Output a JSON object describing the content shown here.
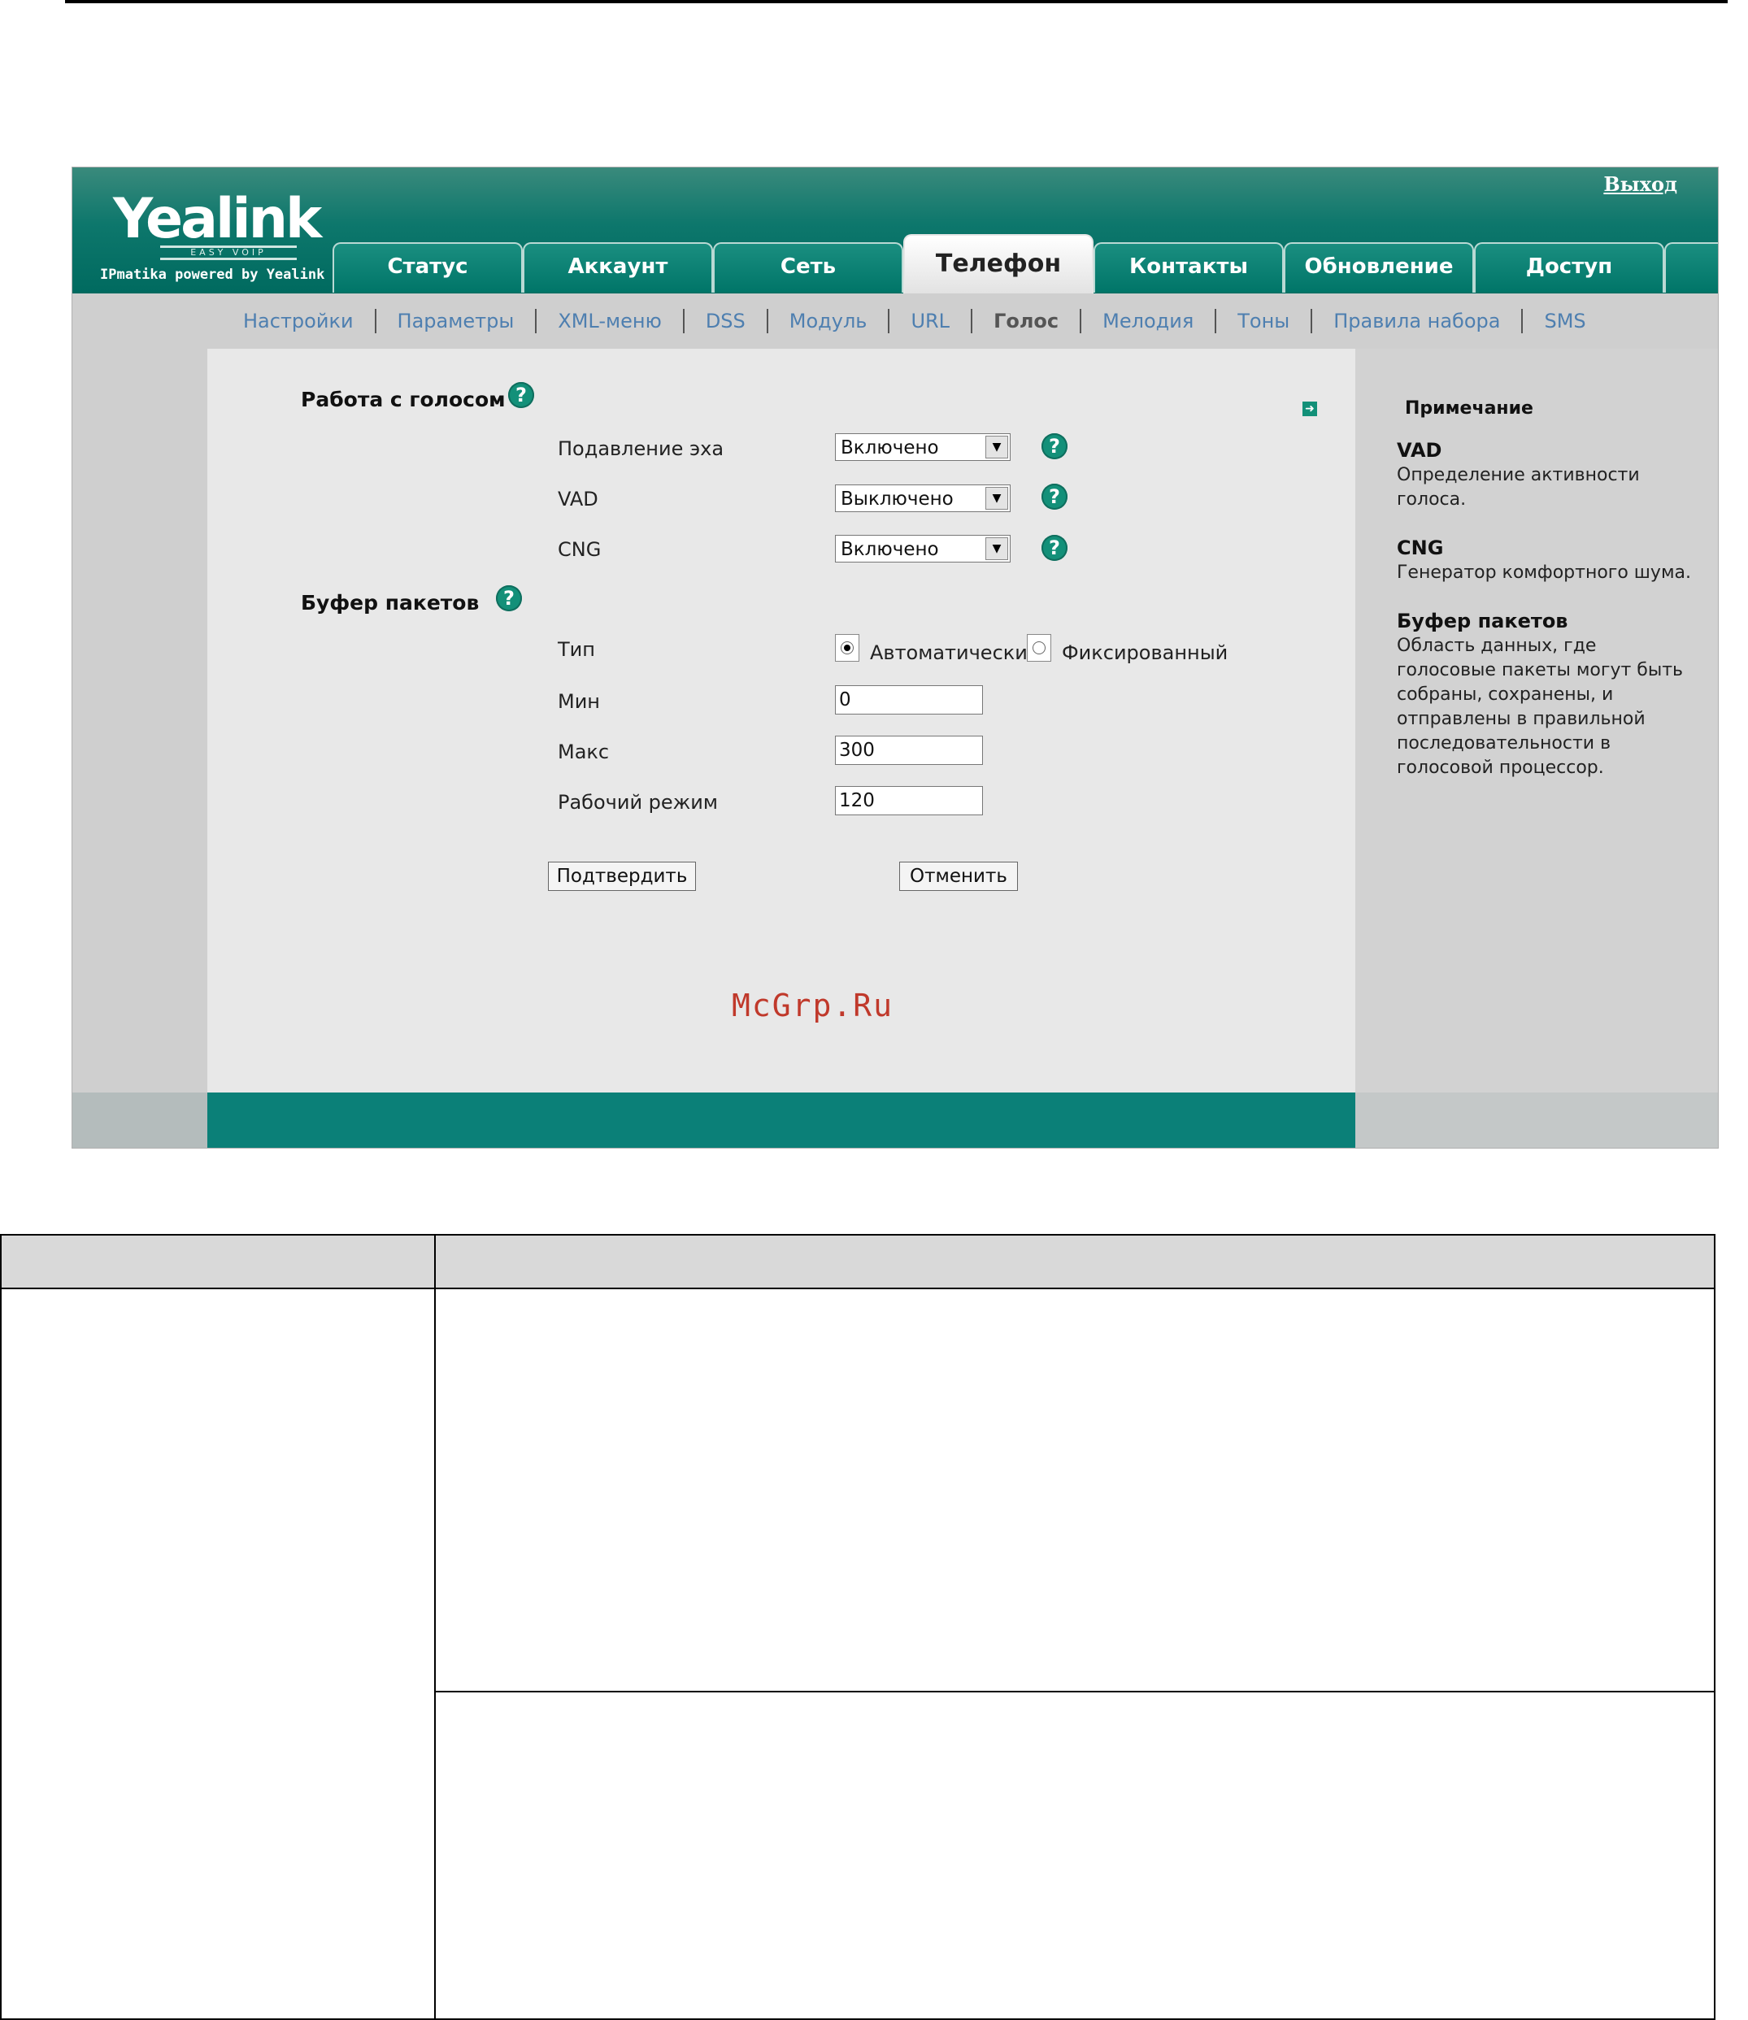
{
  "app": {
    "logo_text": "Yealink",
    "logo_sub": "EASY VOIP",
    "logo_tagline": "IPmatika powered by Yealink",
    "logout_label": "Выход"
  },
  "tabs": [
    {
      "label": "Статус"
    },
    {
      "label": "Аккаунт"
    },
    {
      "label": "Сеть"
    },
    {
      "label": "Телефон",
      "active": true
    },
    {
      "label": "Контакты"
    },
    {
      "label": "Обновление"
    },
    {
      "label": "Доступ"
    }
  ],
  "subnav": [
    {
      "label": "Настройки"
    },
    {
      "label": "Параметры"
    },
    {
      "label": "XML-меню"
    },
    {
      "label": "DSS"
    },
    {
      "label": "Модуль"
    },
    {
      "label": "URL"
    },
    {
      "label": "Голос",
      "active": true
    },
    {
      "label": "Мелодия"
    },
    {
      "label": "Тоны"
    },
    {
      "label": "Правила набора"
    },
    {
      "label": "SMS"
    }
  ],
  "voice": {
    "title": "Работа с голосом",
    "echo": {
      "label": "Подавление эха",
      "value": "Включено"
    },
    "vad": {
      "label": "VAD",
      "value": "Выключено"
    },
    "cng": {
      "label": "CNG",
      "value": "Включено"
    }
  },
  "buffer": {
    "title": "Буфер пакетов",
    "type_label": "Тип",
    "type_auto": "Автоматический",
    "type_fixed": "Фиксированный",
    "type_selected": "Автоматический",
    "min_label": "Мин",
    "min_value": "0",
    "max_label": "Макс",
    "max_value": "300",
    "work_label": "Рабочий режим",
    "work_value": "120"
  },
  "buttons": {
    "confirm": "Подтвердить",
    "cancel": "Отменить"
  },
  "watermark": "McGrp.Ru",
  "note": {
    "title": "Примечание",
    "items": [
      {
        "term": "VAD",
        "desc": "Определение активности голоса."
      },
      {
        "term": "CNG",
        "desc": "Генератор комфортного шума."
      },
      {
        "term": "Буфер пакетов",
        "desc": "Область данных, где голосовые пакеты могут быть собраны, сохранены, и отправлены в правильной последовательности в голосовой процессор."
      }
    ]
  },
  "colors": {
    "brand_teal": "#0b8078",
    "help_icon": "#139079",
    "subnav_link": "#4e7fb0"
  }
}
